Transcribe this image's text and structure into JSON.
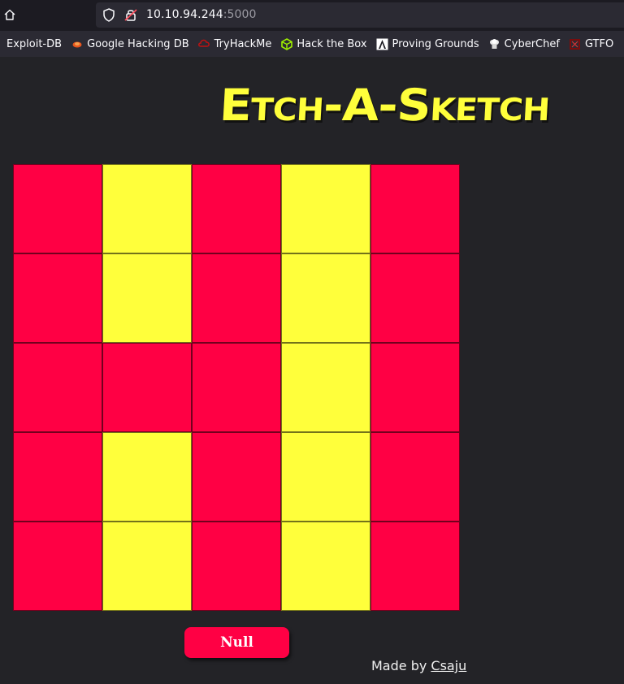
{
  "browser": {
    "url_host": "10.10.94.244",
    "url_port": ":5000"
  },
  "bookmarks": [
    {
      "label": "Exploit-DB",
      "icon": "exploit-db-icon"
    },
    {
      "label": "Google Hacking DB",
      "icon": "ghdb-icon"
    },
    {
      "label": "TryHackMe",
      "icon": "tryhackme-icon"
    },
    {
      "label": "Hack the Box",
      "icon": "hackthebox-icon"
    },
    {
      "label": "Proving Grounds",
      "icon": "proving-grounds-icon"
    },
    {
      "label": "CyberChef",
      "icon": "cyberchef-icon"
    },
    {
      "label": "GTFO",
      "icon": "gtfobins-icon"
    }
  ],
  "page": {
    "title": "Etch-A-Sketch",
    "button_label": "Null",
    "credit_prefix": "Made by ",
    "credit_link": "Csaju"
  },
  "colors": {
    "red": "#ff0044",
    "yellow": "#ffff3b",
    "background": "#232327"
  },
  "grid": {
    "rows": [
      [
        "red",
        "yellow",
        "red",
        "yellow",
        "red"
      ],
      [
        "red",
        "yellow",
        "red",
        "yellow",
        "red"
      ],
      [
        "red",
        "red",
        "red",
        "yellow",
        "red"
      ],
      [
        "red",
        "yellow",
        "red",
        "yellow",
        "red"
      ],
      [
        "red",
        "yellow",
        "red",
        "yellow",
        "red"
      ]
    ]
  }
}
